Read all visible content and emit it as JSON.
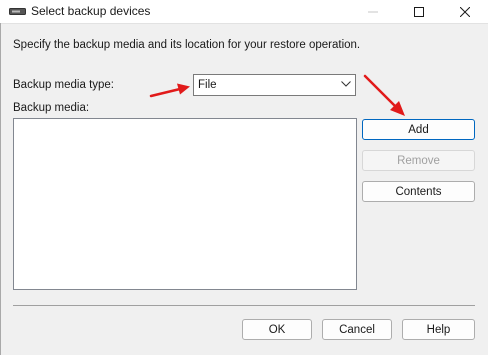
{
  "window": {
    "title": "Select backup devices",
    "controls": [
      "minimize-icon",
      "maximize-icon",
      "close-icon"
    ]
  },
  "instructions": "Specify the backup media and its location for your restore operation.",
  "media_type": {
    "label": "Backup media type:",
    "selected": "File"
  },
  "media_list": {
    "label": "Backup media:",
    "items": []
  },
  "side_buttons": {
    "add": "Add",
    "remove": "Remove",
    "contents": "Contents"
  },
  "footer_buttons": {
    "ok": "OK",
    "cancel": "Cancel",
    "help": "Help"
  },
  "annotation": {
    "arrow_color": "#e11a1a",
    "arrow_targets": [
      "backup-media-type-select",
      "add-button"
    ]
  },
  "colors": {
    "default_button_border": "#0067c0",
    "disabled_text": "#a0a0a0"
  }
}
